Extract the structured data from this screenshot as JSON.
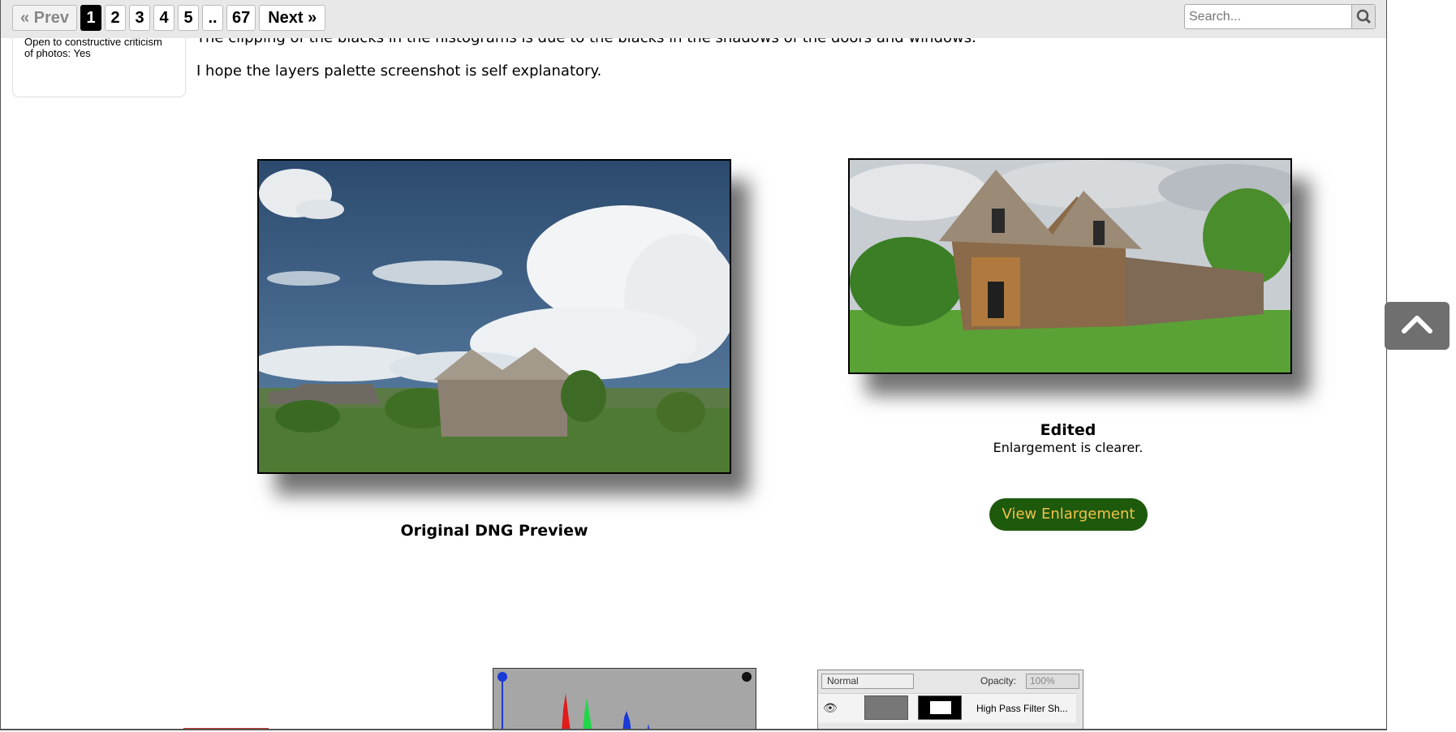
{
  "pagination": {
    "prev_label": "« Prev",
    "pages": [
      "1",
      "2",
      "3",
      "4",
      "5",
      "..",
      "67"
    ],
    "current": "1",
    "next_label": "Next »"
  },
  "search": {
    "placeholder": "Search..."
  },
  "user_card": {
    "criticism_line1": "Open to constructive criticism",
    "criticism_line2": "of photos: Yes"
  },
  "post": {
    "clipped_line": "The clipping of the blacks in the histograms is due to the blacks in the shadows of the doors and windows.",
    "layers_line": "I hope the layers palette screenshot is self explanatory."
  },
  "images": {
    "original": {
      "caption": "Original DNG Preview"
    },
    "edited": {
      "caption": "Edited",
      "subcaption": "Enlargement is clearer.",
      "button_label": "View Enlargement"
    }
  },
  "layers_panel": {
    "blend_mode": "Normal",
    "opacity_label": "Opacity:",
    "opacity_value": "100%",
    "layer_name": "High Pass Filter Sh..."
  },
  "colors": {
    "button_bg": "#1e5a0c",
    "button_text": "#f2c14e",
    "current_page_bg": "#000000"
  }
}
